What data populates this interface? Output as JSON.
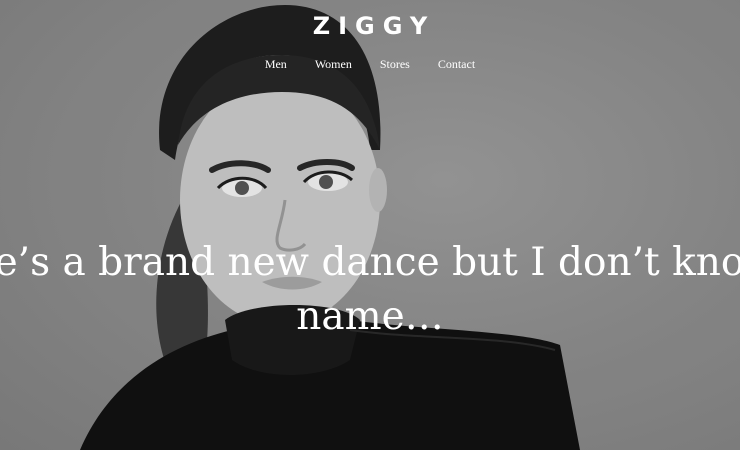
{
  "brand": {
    "logo": "ZIGGY"
  },
  "nav": {
    "items": [
      {
        "label": "Men"
      },
      {
        "label": "Women"
      },
      {
        "label": "Stores"
      },
      {
        "label": "Contact"
      }
    ]
  },
  "hero": {
    "headline": "There’s a brand new dance but I don’t know its name…",
    "image_subject": "black-and-white portrait of a model"
  }
}
